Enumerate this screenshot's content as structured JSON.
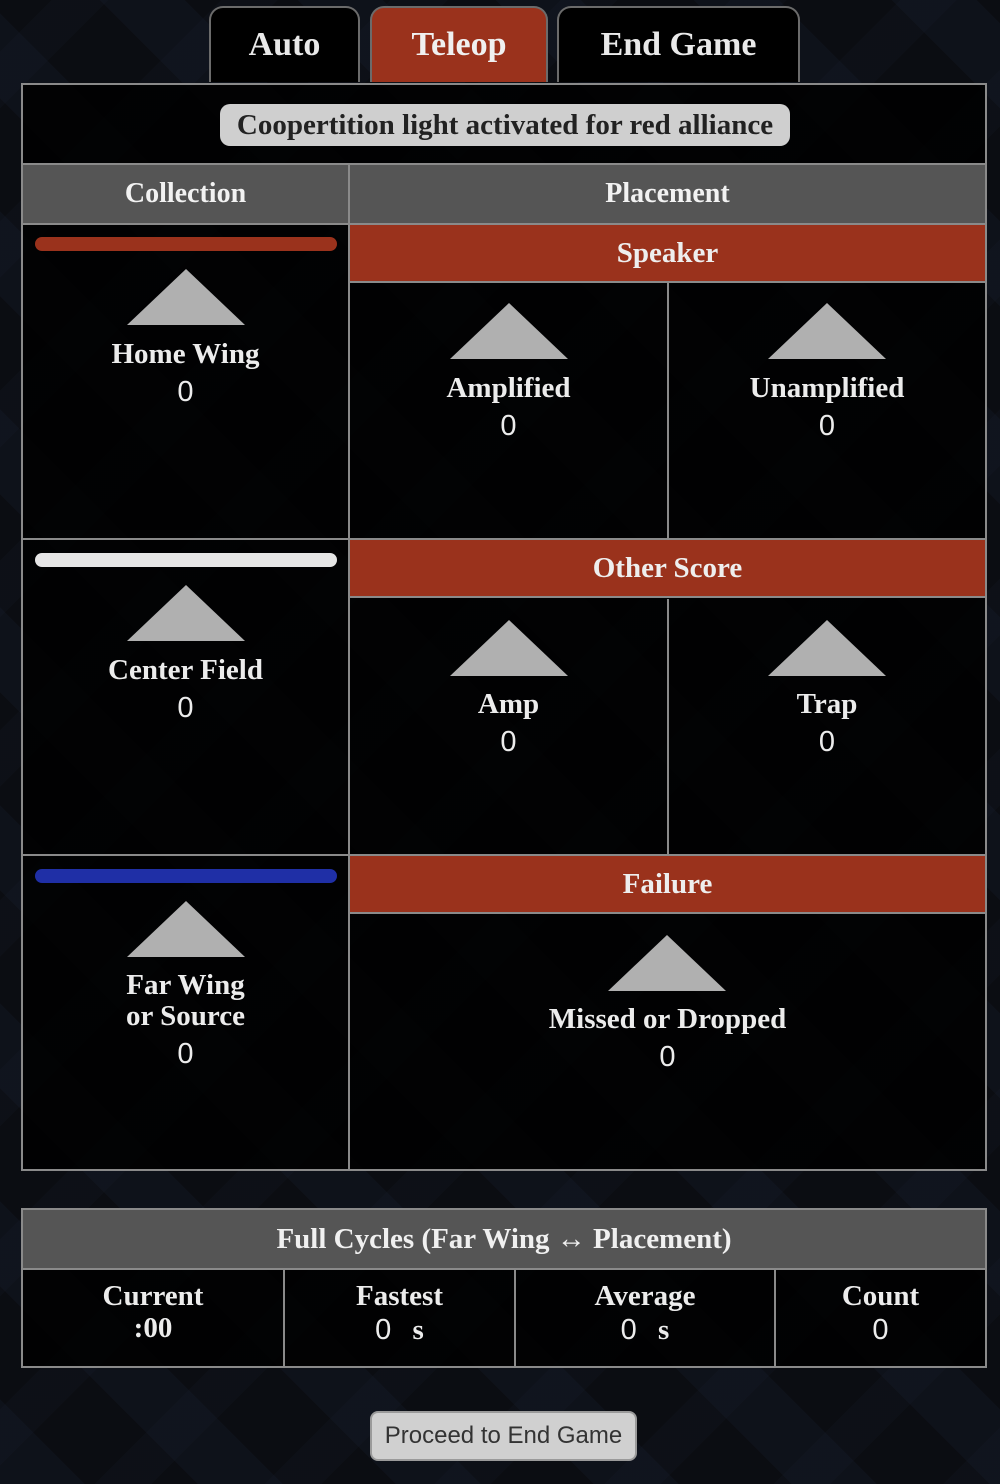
{
  "tabs": {
    "auto": "Auto",
    "teleop": "Teleop",
    "end_game": "End Game"
  },
  "banner": "Coopertition light activated for red alliance",
  "headers": {
    "collection": "Collection",
    "placement": "Placement"
  },
  "collection": {
    "home_wing": {
      "label": "Home Wing",
      "value": "0",
      "bar_color": "#9a321c"
    },
    "center_field": {
      "label": "Center Field",
      "value": "0",
      "bar_color": "#e6e6e6"
    },
    "far_wing": {
      "label_line1": "Far Wing",
      "label_line2": "or Source",
      "value": "0",
      "bar_color": "#1f2fa6"
    }
  },
  "speaker": {
    "title": "Speaker",
    "amplified": {
      "label": "Amplified",
      "value": "0"
    },
    "unamplified": {
      "label": "Unamplified",
      "value": "0"
    }
  },
  "other_score": {
    "title": "Other Score",
    "amp": {
      "label": "Amp",
      "value": "0"
    },
    "trap": {
      "label": "Trap",
      "value": "0"
    }
  },
  "failure": {
    "title": "Failure",
    "missed": {
      "label": "Missed or Dropped",
      "value": "0"
    }
  },
  "cycles": {
    "title": "Full Cycles (Far Wing ↔ Placement)",
    "current": {
      "label": "Current",
      "value": ":00"
    },
    "fastest": {
      "label": "Fastest",
      "value": "0",
      "unit": "s"
    },
    "average": {
      "label": "Average",
      "value": "0",
      "unit": "s"
    },
    "count": {
      "label": "Count",
      "value": "0"
    }
  },
  "proceed_button": "Proceed to End Game",
  "colors": {
    "accent": "#9a321c",
    "header_bg": "#555555"
  }
}
